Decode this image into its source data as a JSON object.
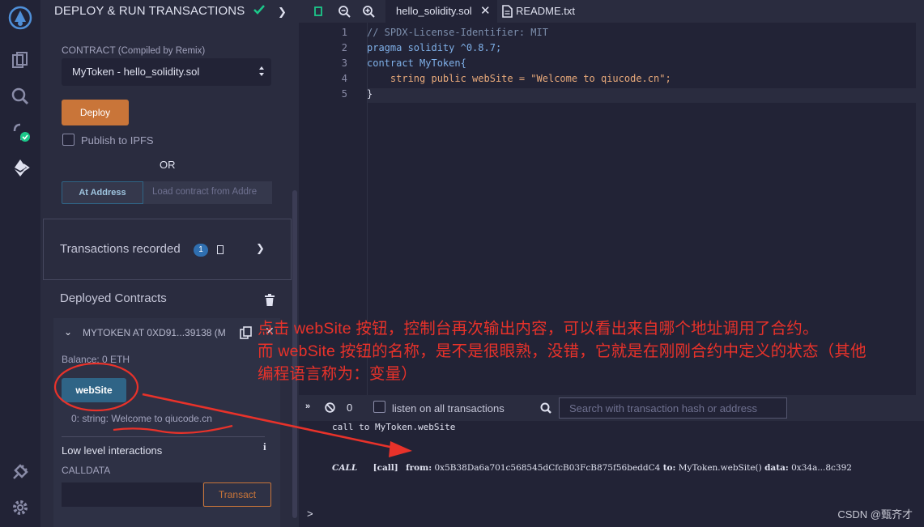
{
  "panel": {
    "title": "DEPLOY & RUN TRANSACTIONS",
    "contract_label": "CONTRACT",
    "contract_sub": "(Compiled by Remix)",
    "contract_selected": "MyToken - hello_solidity.sol",
    "deploy_label": "Deploy",
    "publish_label": "Publish to IPFS",
    "or_label": "OR",
    "at_address_label": "At Address",
    "at_address_placeholder": "Load contract from Addre",
    "transactions_label": "Transactions recorded",
    "transactions_count": "1",
    "deployed_label": "Deployed Contracts",
    "instance_title": "MYTOKEN AT 0XD91...39138 (M",
    "balance": "Balance: 0 ETH",
    "website_button": "webSite",
    "website_result": "0: string: Welcome to qiucode.cn",
    "low_level_label": "Low level interactions",
    "calldata_label": "CALLDATA",
    "transact_label": "Transact"
  },
  "editor": {
    "tabs": [
      "hello_solidity.sol",
      "README.txt"
    ],
    "lines": [
      {
        "num": "1",
        "text": "// SPDX-License-Identifier: MIT"
      },
      {
        "num": "2",
        "text": "pragma solidity ^0.8.7;"
      },
      {
        "num": "3",
        "text": "contract MyToken{"
      },
      {
        "num": "4",
        "text": "    string public webSite = \"Welcome to qiucode.cn\";"
      },
      {
        "num": "5",
        "text": "}"
      }
    ]
  },
  "terminal": {
    "count": "0",
    "listen_label": "listen on all transactions",
    "search_placeholder": "Search with transaction hash or address",
    "call_line": "call to MyToken.webSite",
    "log_call": "CALL",
    "log_tag": "[call]",
    "log_from_label": "from:",
    "log_from": "0x5B38Da6a701c568545dCfcB03FcB875f56beddC4",
    "log_to_label": "to:",
    "log_to": "MyToken.webSite()",
    "log_data_label": "data:",
    "log_data": "0x34a...8c392",
    "prompt": ">"
  },
  "annotation": {
    "line1": "点击 webSite 按钮，控制台再次输出内容，可以看出来自哪个地址调用了合约。",
    "line2": "而 webSite 按钮的名称，是不是很眼熟，没错，它就是在刚刚合约中定义的状态（其他",
    "line3": "编程语言称为：变量）"
  },
  "watermark": "CSDN @甄齐才",
  "colors": {
    "accent_orange": "#c97539",
    "accent_blue": "#2f6486",
    "annotation_red": "#e8322a",
    "success_green": "#1cc88a"
  }
}
